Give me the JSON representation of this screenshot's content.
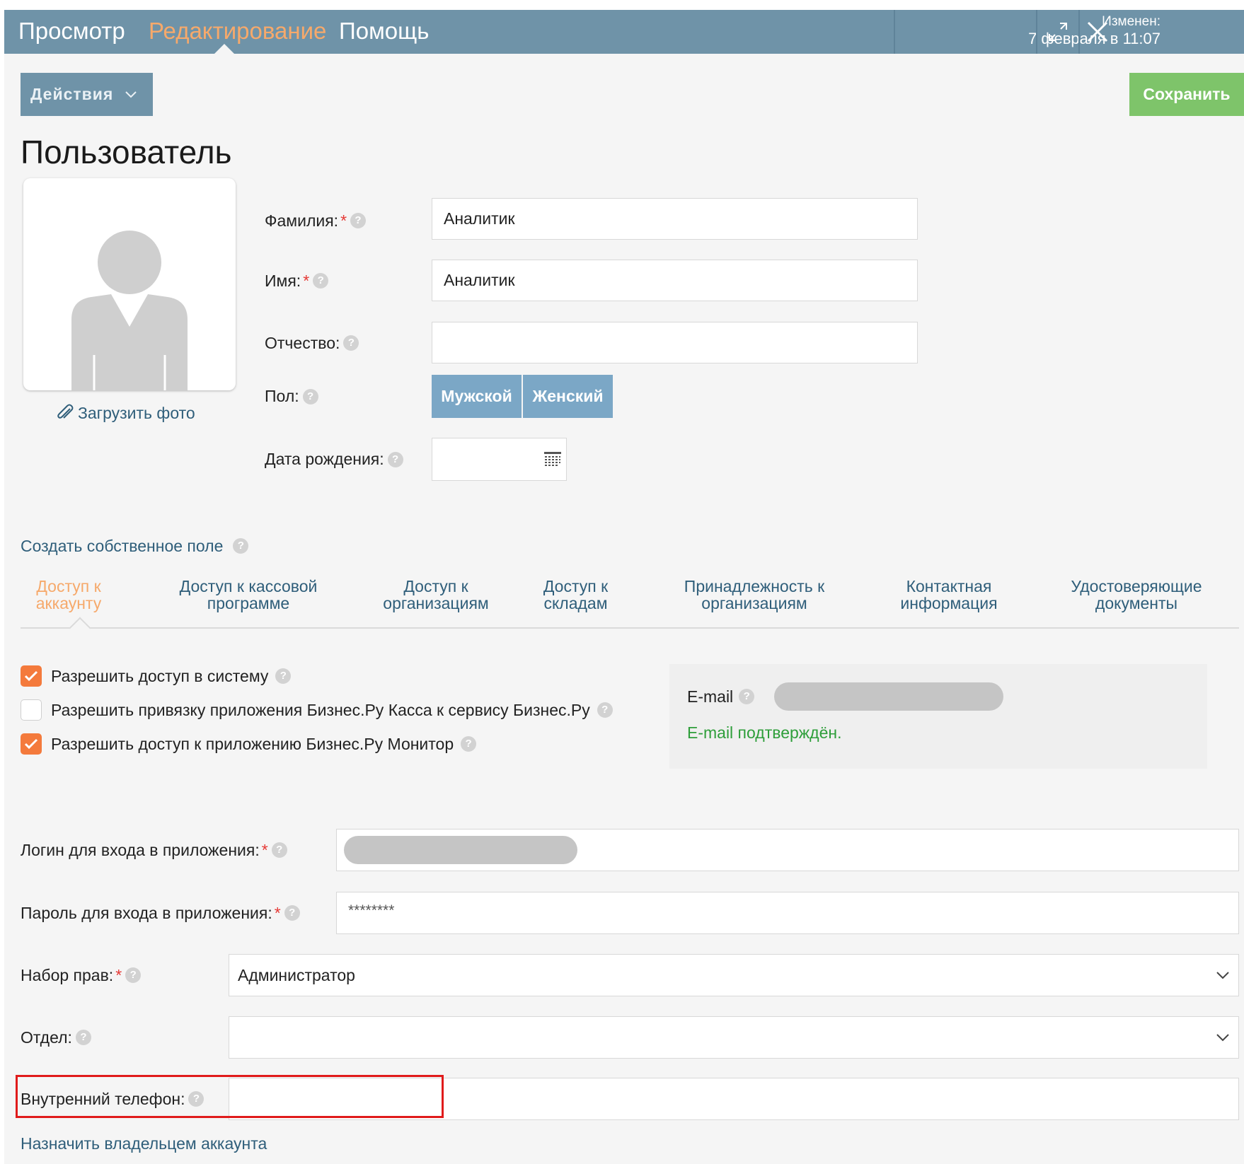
{
  "topbar": {
    "tabs": [
      {
        "label": "Просмотр",
        "active": false
      },
      {
        "label": "Редактирование",
        "active": true
      },
      {
        "label": "Помощь",
        "active": false
      }
    ],
    "changed_label": "Изменен:",
    "changed_value": "7 февраля в 11:07",
    "expand_icon": "expand-icon",
    "close_icon": "close-icon"
  },
  "toolbar": {
    "actions_label": "Действия",
    "save_label": "Сохранить"
  },
  "page": {
    "title": "Пользователь",
    "upload_photo": "Загрузить фото"
  },
  "form": {
    "last_name": {
      "label": "Фамилия:",
      "value": "Аналитик",
      "required": true
    },
    "first_name": {
      "label": "Имя:",
      "value": "Аналитик",
      "required": true
    },
    "middle_name": {
      "label": "Отчество:",
      "value": ""
    },
    "gender": {
      "label": "Пол:",
      "options": [
        "Мужской",
        "Женский"
      ]
    },
    "birth_date": {
      "label": "Дата рождения:",
      "value": ""
    }
  },
  "custom_field_link": "Создать собственное поле",
  "subtabs": [
    {
      "line1": "Доступ к",
      "line2": "аккаунту",
      "active": true
    },
    {
      "line1": "Доступ к кассовой",
      "line2": "программе",
      "active": false
    },
    {
      "line1": "Доступ к",
      "line2": "организациям",
      "active": false
    },
    {
      "line1": "Доступ к",
      "line2": "складам",
      "active": false
    },
    {
      "line1": "Принадлежность к",
      "line2": "организациям",
      "active": false
    },
    {
      "line1": "Контактная",
      "line2": "информация",
      "active": false
    },
    {
      "line1": "Удостоверяющие",
      "line2": "документы",
      "active": false
    }
  ],
  "access": {
    "checkboxes": [
      {
        "label": "Разрешить доступ в систему",
        "checked": true
      },
      {
        "label": "Разрешить привязку приложения Бизнес.Ру Касса к сервису Бизнес.Ру",
        "checked": false
      },
      {
        "label": "Разрешить доступ к приложению Бизнес.Ру Монитор",
        "checked": true
      }
    ],
    "email_label": "E-mail",
    "email_status": "E-mail подтверждён."
  },
  "account": {
    "login_label": "Логин для входа в приложения:",
    "password_label": "Пароль для входа в приложения:",
    "password_value": "********",
    "rights_label": "Набор прав:",
    "rights_value": "Администратор",
    "department_label": "Отдел:",
    "department_value": "",
    "phone_label": "Внутренний телефон:",
    "phone_value": "",
    "owner_link": "Назначить владельцем аккаунта"
  },
  "colors": {
    "topbar": "#6f93a8",
    "accent_orange": "#f6a96b",
    "save_green": "#7ec46a",
    "link_blue": "#2f5e7a",
    "checkbox_orange": "#f47a3c",
    "confirm_green": "#2e9e3a",
    "highlight_red": "#e01b1b"
  }
}
